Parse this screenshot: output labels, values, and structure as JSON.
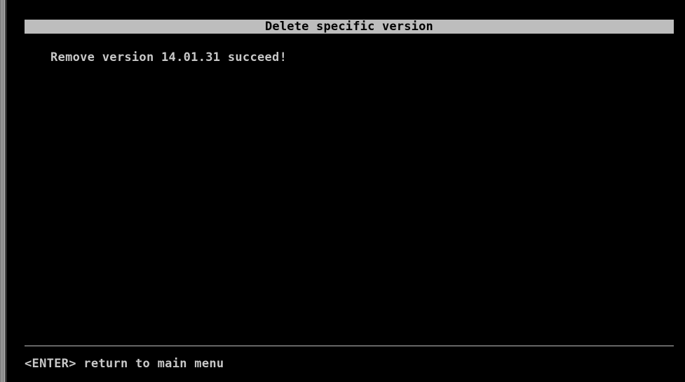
{
  "window": {
    "title": "Delete specific version"
  },
  "main": {
    "message": "Remove version 14.01.31 succeed!"
  },
  "footer": {
    "hint": "<ENTER> return to main menu"
  },
  "colors": {
    "background": "#000000",
    "title_bar": "#bdbdbd",
    "text": "#c8c8c8"
  }
}
